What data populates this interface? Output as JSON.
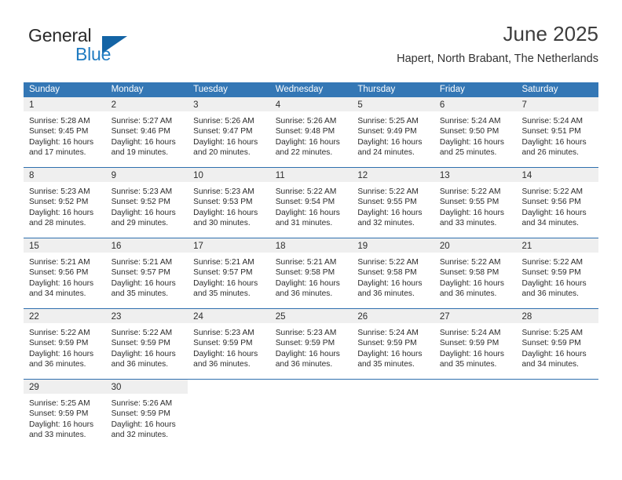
{
  "brand": {
    "word_one": "General",
    "word_two": "Blue",
    "flag_icon": "triangle-flag-icon",
    "accent_color": "#1464a5",
    "blue_text_color": "#1f7bc1"
  },
  "header": {
    "title": "June 2025",
    "subtitle": "Hapert, North Brabant, The Netherlands"
  },
  "calendar": {
    "header_bg": "#3477b5",
    "row_divider": "#2f6fae",
    "daynum_band_bg": "#efefef",
    "weekdays": [
      "Sunday",
      "Monday",
      "Tuesday",
      "Wednesday",
      "Thursday",
      "Friday",
      "Saturday"
    ],
    "weeks": [
      [
        {
          "day": "1",
          "sunrise": "Sunrise: 5:28 AM",
          "sunset": "Sunset: 9:45 PM",
          "daylight_1": "Daylight: 16 hours",
          "daylight_2": "and 17 minutes."
        },
        {
          "day": "2",
          "sunrise": "Sunrise: 5:27 AM",
          "sunset": "Sunset: 9:46 PM",
          "daylight_1": "Daylight: 16 hours",
          "daylight_2": "and 19 minutes."
        },
        {
          "day": "3",
          "sunrise": "Sunrise: 5:26 AM",
          "sunset": "Sunset: 9:47 PM",
          "daylight_1": "Daylight: 16 hours",
          "daylight_2": "and 20 minutes."
        },
        {
          "day": "4",
          "sunrise": "Sunrise: 5:26 AM",
          "sunset": "Sunset: 9:48 PM",
          "daylight_1": "Daylight: 16 hours",
          "daylight_2": "and 22 minutes."
        },
        {
          "day": "5",
          "sunrise": "Sunrise: 5:25 AM",
          "sunset": "Sunset: 9:49 PM",
          "daylight_1": "Daylight: 16 hours",
          "daylight_2": "and 24 minutes."
        },
        {
          "day": "6",
          "sunrise": "Sunrise: 5:24 AM",
          "sunset": "Sunset: 9:50 PM",
          "daylight_1": "Daylight: 16 hours",
          "daylight_2": "and 25 minutes."
        },
        {
          "day": "7",
          "sunrise": "Sunrise: 5:24 AM",
          "sunset": "Sunset: 9:51 PM",
          "daylight_1": "Daylight: 16 hours",
          "daylight_2": "and 26 minutes."
        }
      ],
      [
        {
          "day": "8",
          "sunrise": "Sunrise: 5:23 AM",
          "sunset": "Sunset: 9:52 PM",
          "daylight_1": "Daylight: 16 hours",
          "daylight_2": "and 28 minutes."
        },
        {
          "day": "9",
          "sunrise": "Sunrise: 5:23 AM",
          "sunset": "Sunset: 9:52 PM",
          "daylight_1": "Daylight: 16 hours",
          "daylight_2": "and 29 minutes."
        },
        {
          "day": "10",
          "sunrise": "Sunrise: 5:23 AM",
          "sunset": "Sunset: 9:53 PM",
          "daylight_1": "Daylight: 16 hours",
          "daylight_2": "and 30 minutes."
        },
        {
          "day": "11",
          "sunrise": "Sunrise: 5:22 AM",
          "sunset": "Sunset: 9:54 PM",
          "daylight_1": "Daylight: 16 hours",
          "daylight_2": "and 31 minutes."
        },
        {
          "day": "12",
          "sunrise": "Sunrise: 5:22 AM",
          "sunset": "Sunset: 9:55 PM",
          "daylight_1": "Daylight: 16 hours",
          "daylight_2": "and 32 minutes."
        },
        {
          "day": "13",
          "sunrise": "Sunrise: 5:22 AM",
          "sunset": "Sunset: 9:55 PM",
          "daylight_1": "Daylight: 16 hours",
          "daylight_2": "and 33 minutes."
        },
        {
          "day": "14",
          "sunrise": "Sunrise: 5:22 AM",
          "sunset": "Sunset: 9:56 PM",
          "daylight_1": "Daylight: 16 hours",
          "daylight_2": "and 34 minutes."
        }
      ],
      [
        {
          "day": "15",
          "sunrise": "Sunrise: 5:21 AM",
          "sunset": "Sunset: 9:56 PM",
          "daylight_1": "Daylight: 16 hours",
          "daylight_2": "and 34 minutes."
        },
        {
          "day": "16",
          "sunrise": "Sunrise: 5:21 AM",
          "sunset": "Sunset: 9:57 PM",
          "daylight_1": "Daylight: 16 hours",
          "daylight_2": "and 35 minutes."
        },
        {
          "day": "17",
          "sunrise": "Sunrise: 5:21 AM",
          "sunset": "Sunset: 9:57 PM",
          "daylight_1": "Daylight: 16 hours",
          "daylight_2": "and 35 minutes."
        },
        {
          "day": "18",
          "sunrise": "Sunrise: 5:21 AM",
          "sunset": "Sunset: 9:58 PM",
          "daylight_1": "Daylight: 16 hours",
          "daylight_2": "and 36 minutes."
        },
        {
          "day": "19",
          "sunrise": "Sunrise: 5:22 AM",
          "sunset": "Sunset: 9:58 PM",
          "daylight_1": "Daylight: 16 hours",
          "daylight_2": "and 36 minutes."
        },
        {
          "day": "20",
          "sunrise": "Sunrise: 5:22 AM",
          "sunset": "Sunset: 9:58 PM",
          "daylight_1": "Daylight: 16 hours",
          "daylight_2": "and 36 minutes."
        },
        {
          "day": "21",
          "sunrise": "Sunrise: 5:22 AM",
          "sunset": "Sunset: 9:59 PM",
          "daylight_1": "Daylight: 16 hours",
          "daylight_2": "and 36 minutes."
        }
      ],
      [
        {
          "day": "22",
          "sunrise": "Sunrise: 5:22 AM",
          "sunset": "Sunset: 9:59 PM",
          "daylight_1": "Daylight: 16 hours",
          "daylight_2": "and 36 minutes."
        },
        {
          "day": "23",
          "sunrise": "Sunrise: 5:22 AM",
          "sunset": "Sunset: 9:59 PM",
          "daylight_1": "Daylight: 16 hours",
          "daylight_2": "and 36 minutes."
        },
        {
          "day": "24",
          "sunrise": "Sunrise: 5:23 AM",
          "sunset": "Sunset: 9:59 PM",
          "daylight_1": "Daylight: 16 hours",
          "daylight_2": "and 36 minutes."
        },
        {
          "day": "25",
          "sunrise": "Sunrise: 5:23 AM",
          "sunset": "Sunset: 9:59 PM",
          "daylight_1": "Daylight: 16 hours",
          "daylight_2": "and 36 minutes."
        },
        {
          "day": "26",
          "sunrise": "Sunrise: 5:24 AM",
          "sunset": "Sunset: 9:59 PM",
          "daylight_1": "Daylight: 16 hours",
          "daylight_2": "and 35 minutes."
        },
        {
          "day": "27",
          "sunrise": "Sunrise: 5:24 AM",
          "sunset": "Sunset: 9:59 PM",
          "daylight_1": "Daylight: 16 hours",
          "daylight_2": "and 35 minutes."
        },
        {
          "day": "28",
          "sunrise": "Sunrise: 5:25 AM",
          "sunset": "Sunset: 9:59 PM",
          "daylight_1": "Daylight: 16 hours",
          "daylight_2": "and 34 minutes."
        }
      ],
      [
        {
          "day": "29",
          "sunrise": "Sunrise: 5:25 AM",
          "sunset": "Sunset: 9:59 PM",
          "daylight_1": "Daylight: 16 hours",
          "daylight_2": "and 33 minutes."
        },
        {
          "day": "30",
          "sunrise": "Sunrise: 5:26 AM",
          "sunset": "Sunset: 9:59 PM",
          "daylight_1": "Daylight: 16 hours",
          "daylight_2": "and 32 minutes."
        },
        {
          "day": "",
          "sunrise": "",
          "sunset": "",
          "daylight_1": "",
          "daylight_2": ""
        },
        {
          "day": "",
          "sunrise": "",
          "sunset": "",
          "daylight_1": "",
          "daylight_2": ""
        },
        {
          "day": "",
          "sunrise": "",
          "sunset": "",
          "daylight_1": "",
          "daylight_2": ""
        },
        {
          "day": "",
          "sunrise": "",
          "sunset": "",
          "daylight_1": "",
          "daylight_2": ""
        },
        {
          "day": "",
          "sunrise": "",
          "sunset": "",
          "daylight_1": "",
          "daylight_2": ""
        }
      ]
    ]
  }
}
